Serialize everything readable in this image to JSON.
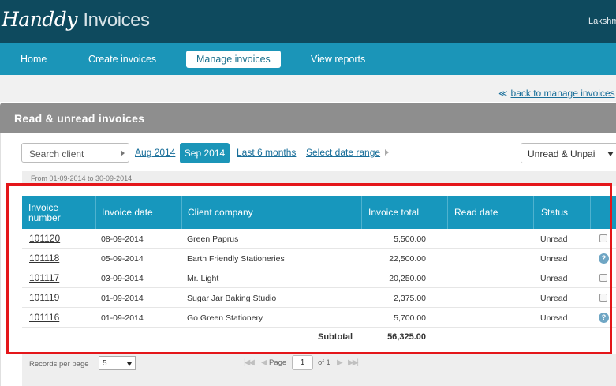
{
  "app": {
    "logo_script": "Handdy",
    "logo_plain": "Invoices",
    "user_name": "Lakshm"
  },
  "nav": {
    "items": [
      {
        "label": "Home",
        "active": false
      },
      {
        "label": "Create invoices",
        "active": false
      },
      {
        "label": "Manage invoices",
        "active": true
      },
      {
        "label": "View reports",
        "active": false
      }
    ]
  },
  "back_link": "back to manage invoices",
  "panel_title": "Read & unread invoices",
  "filters": {
    "search_placeholder": "Search client",
    "ranges": [
      "Aug 2014",
      "Sep 2014",
      "Last 6 months",
      "Select date range"
    ],
    "active_range": "Sep 2014",
    "status_value": "Unread & Unpai"
  },
  "date_range_text": "From 01-09-2014 to 30-09-2014",
  "table": {
    "columns": [
      "Invoice number",
      "Invoice date",
      "Client company",
      "Invoice total",
      "Read date",
      "Status"
    ],
    "rows": [
      {
        "number": "101120",
        "date": "08-09-2014",
        "client": "Green Paprus",
        "total": "5,500.00",
        "read_date": "",
        "status": "Unread",
        "action": "checkbox"
      },
      {
        "number": "101118",
        "date": "05-09-2014",
        "client": "Earth Friendly Stationeries",
        "total": "22,500.00",
        "read_date": "",
        "status": "Unread",
        "action": "help"
      },
      {
        "number": "101117",
        "date": "03-09-2014",
        "client": "Mr. Light",
        "total": "20,250.00",
        "read_date": "",
        "status": "Unread",
        "action": "checkbox"
      },
      {
        "number": "101119",
        "date": "01-09-2014",
        "client": "Sugar Jar Baking Studio",
        "total": "2,375.00",
        "read_date": "",
        "status": "Unread",
        "action": "checkbox"
      },
      {
        "number": "101116",
        "date": "01-09-2014",
        "client": "Go Green Stationery",
        "total": "5,700.00",
        "read_date": "",
        "status": "Unread",
        "action": "help"
      }
    ],
    "subtotal_label": "Subtotal",
    "subtotal_value": "56,325.00"
  },
  "pagination": {
    "records_label": "Records per page",
    "records_value": "5",
    "page_label": "Page",
    "page_value": "1",
    "of_label": "of 1"
  },
  "colors": {
    "topbar": "#0e4a5e",
    "nav": "#1b95b8",
    "table_header": "#1797bd",
    "highlight": "#e4161a"
  }
}
